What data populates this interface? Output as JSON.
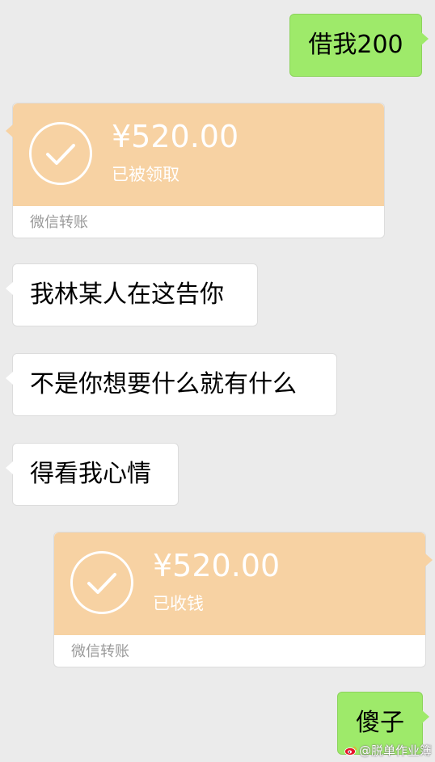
{
  "messages": {
    "m1": {
      "sender": "me",
      "text": "借我200"
    },
    "m2": {
      "sender": "other",
      "type": "transfer",
      "amount": "¥520.00",
      "status": "已被领取",
      "footer": "微信转账"
    },
    "m3": {
      "sender": "other",
      "text": "我林某人在这告你"
    },
    "m4": {
      "sender": "other",
      "text": "不是你想要什么就有什么"
    },
    "m5": {
      "sender": "other",
      "text": "得看我心情"
    },
    "m6": {
      "sender": "me",
      "type": "transfer",
      "amount": "¥520.00",
      "status": "已收钱",
      "footer": "微信转账"
    },
    "m7": {
      "sender": "me",
      "text": "傻子"
    }
  },
  "watermark": {
    "text": "@脱单作业簿",
    "icon": "weibo-icon"
  },
  "colors": {
    "background": "#ebebeb",
    "outgoing_bubble": "#9eea6a",
    "incoming_bubble": "#ffffff",
    "transfer_card": "#f7d2a3"
  }
}
